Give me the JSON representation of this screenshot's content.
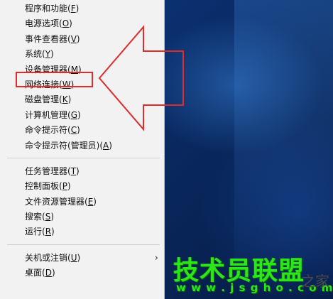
{
  "menu": {
    "group1": [
      {
        "text": "程序和功能(",
        "key": "F",
        "end": ")"
      },
      {
        "text": "电源选项(",
        "key": "O",
        "end": ")"
      },
      {
        "text": "事件查看器(",
        "key": "V",
        "end": ")"
      },
      {
        "text": "系统(",
        "key": "Y",
        "end": ")"
      },
      {
        "text": "设备管理器(",
        "key": "M",
        "end": ")"
      },
      {
        "text": "网络连接(",
        "key": "W",
        "end": ")"
      },
      {
        "text": "磁盘管理(",
        "key": "K",
        "end": ")"
      },
      {
        "text": "计算机管理(",
        "key": "G",
        "end": ")"
      },
      {
        "text": "命令提示符(",
        "key": "C",
        "end": ")"
      },
      {
        "text": "命令提示符(管理员)(",
        "key": "A",
        "end": ")"
      }
    ],
    "group2": [
      {
        "text": "任务管理器(",
        "key": "T",
        "end": ")"
      },
      {
        "text": "控制面板(",
        "key": "P",
        "end": ")"
      },
      {
        "text": "文件资源管理器(",
        "key": "E",
        "end": ")"
      },
      {
        "text": "搜索(",
        "key": "S",
        "end": ")"
      },
      {
        "text": "运行(",
        "key": "R",
        "end": ")"
      }
    ],
    "group3": [
      {
        "text": "关机或注销(",
        "key": "U",
        "end": ")",
        "submenu": "›"
      },
      {
        "text": "桌面(",
        "key": "D",
        "end": ")"
      }
    ]
  },
  "annotation": {
    "color": "#e02b2b"
  },
  "watermark": {
    "title": "技术员联盟",
    "url": "w w w . j s g h o . c o m",
    "tail": "之家",
    "color": "#2ee51c"
  }
}
